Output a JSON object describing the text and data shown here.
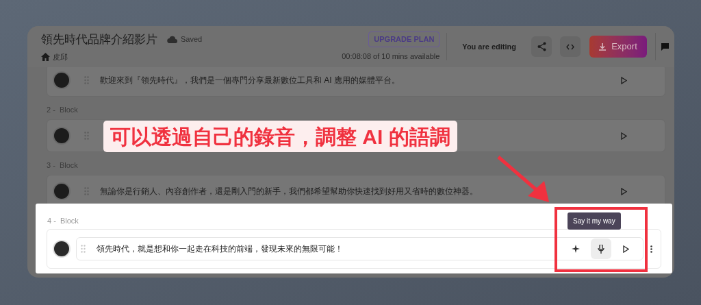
{
  "project": {
    "title": "領先時代品牌介紹影片",
    "save_status": "Saved",
    "breadcrumb": "皮邱"
  },
  "plan": {
    "upgrade_label": "UPGRADE PLAN",
    "usage": "00:08:08 of 10 mins available"
  },
  "editing_label": "You are editing",
  "export_label": "Export",
  "blocks": [
    {
      "text": "歡迎來到『領先時代』，我們是一個專門分享最新數位工具和 AI 應用的媒體平台。",
      "active": false
    },
    {
      "heading": "2 -  Block",
      "active": false
    },
    {
      "heading": "3 -  Block",
      "text": "無論你是行銷人、內容創作者，還是剛入門的新手，我們都希望幫助你快速找到好用又省時的數位神器。",
      "active": false
    },
    {
      "heading": "4 -  Block",
      "text": "領先時代，就是想和你一起走在科技的前端，發現未來的無限可能！",
      "active": true
    }
  ],
  "tooltip": "Say it my way",
  "annotation": {
    "text": "可以透過自己的錄音，調整 AI 的語調"
  }
}
